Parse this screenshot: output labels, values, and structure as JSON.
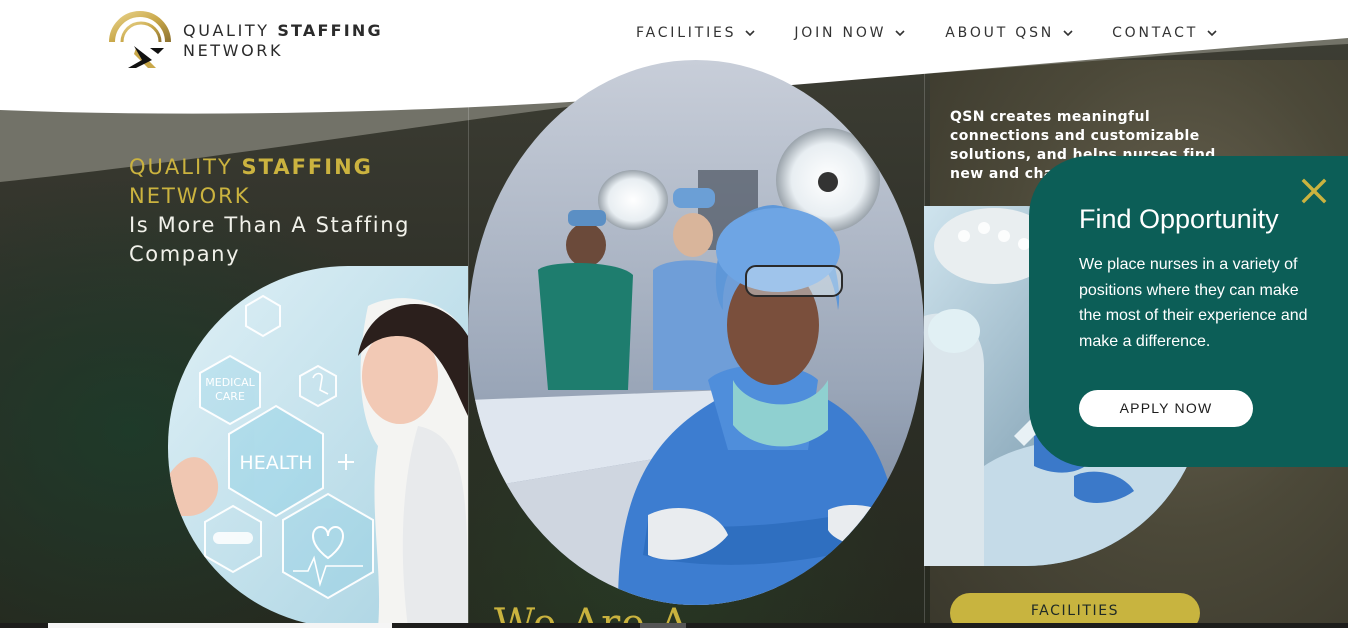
{
  "brand": {
    "line1_regular": "QUALITY",
    "line1_bold": "STAFFING",
    "line2": "NETWORK",
    "logo_icon": "qsn-logo-icon"
  },
  "nav": {
    "items": [
      {
        "label": "FACILITIES",
        "icon": "chevron-down-icon"
      },
      {
        "label": "JOIN NOW",
        "icon": "chevron-down-icon"
      },
      {
        "label": "ABOUT QSN",
        "icon": "chevron-down-icon"
      },
      {
        "label": "CONTACT",
        "icon": "chevron-down-icon"
      }
    ]
  },
  "hero": {
    "title_gold_regular": "QUALITY",
    "title_gold_bold": "STAFFING",
    "title_gold_line2": "NETWORK",
    "subtitle_line1": "Is More Than A Staffing",
    "subtitle_line2": "Company",
    "bottom_heading": "We Are A"
  },
  "intro": {
    "text": "QSN creates meaningful connections and customizable solutions, and helps nurses find new and challenging op"
  },
  "images": {
    "left_health_panel_labels": [
      "MEDICAL CARE",
      "HEALTH"
    ]
  },
  "facilities_button": {
    "label": "FACILITIES"
  },
  "popup": {
    "title": "Find Opportunity",
    "body": "We place nurses in a variety of positions where they can make the most of their experience and make a difference.",
    "cta": "APPLY NOW",
    "close_icon": "close-icon"
  },
  "colors": {
    "gold": "#cbb33f",
    "teal": "#0c5e57",
    "dark_olive": "#2d2f27"
  }
}
